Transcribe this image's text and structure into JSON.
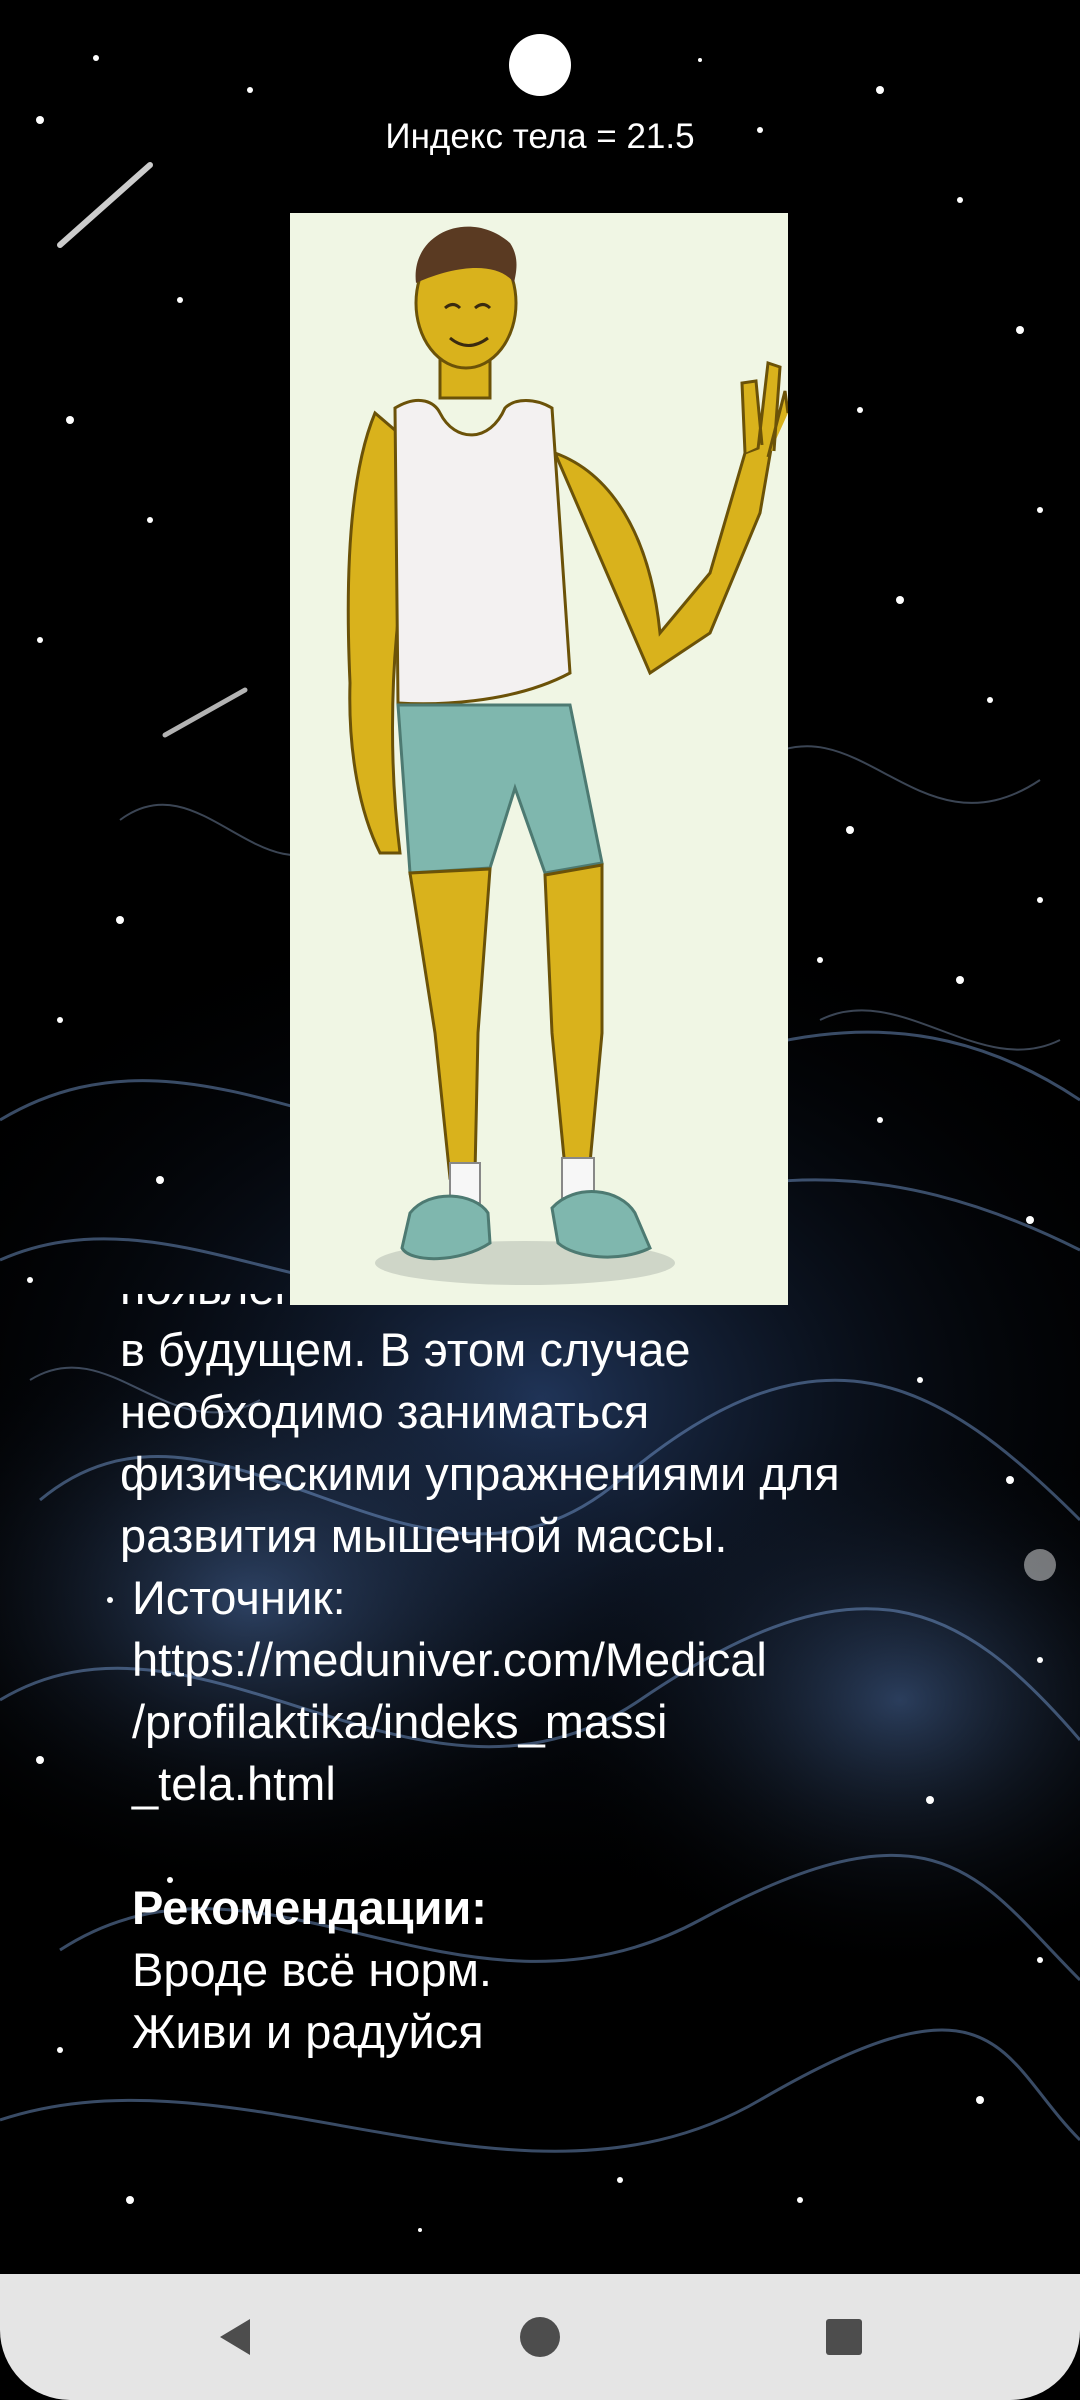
{
  "header": {
    "bmi_text": "Индекс тела = 21.5"
  },
  "illustration": {
    "icon": "person-waving-illustration",
    "colors": {
      "card_bg": "#f0f6e4",
      "skin": "#d9b21c",
      "shirt": "#f3f1f1",
      "shorts": "#7fb7ae",
      "hair": "#5a3a22",
      "shoes": "#7fb7ae"
    }
  },
  "article": {
    "partial_top_line": "появление лишнего веса",
    "body_text": "в будущем. В этом случае\nнеобходимо заниматься\nфизическими упражнениями для\nразвития мышечной массы.",
    "source_label": "Источник:",
    "source_url": "https://meduniver.com/Medical\n/profilaktika/indeks_massi\n_tela.html",
    "recommendations_title": "Рекомендации:",
    "recommendations_text": "Вроде всё норм.\nЖиви и радуйся"
  },
  "navbar": {
    "back_icon": "back-triangle-icon",
    "home_icon": "home-circle-icon",
    "recents_icon": "recents-square-icon",
    "color": "#e5e5e5"
  }
}
